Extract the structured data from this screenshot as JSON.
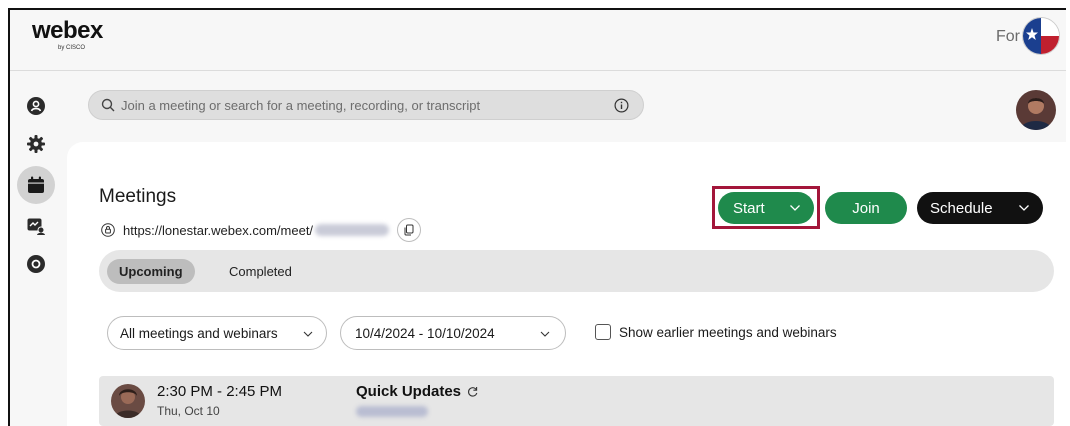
{
  "header": {
    "logo_text": "webex",
    "logo_subtext": "by CISCO",
    "user_name": "For"
  },
  "sidebar": {
    "items": [
      {
        "icon": "contacts-icon"
      },
      {
        "icon": "gear-icon"
      },
      {
        "icon": "calendar-icon",
        "active": true
      },
      {
        "icon": "whiteboard-icon"
      },
      {
        "icon": "record-icon"
      }
    ]
  },
  "search": {
    "placeholder": "Join a meeting or search for a meeting, recording, or transcript"
  },
  "meetings": {
    "title": "Meetings",
    "url_prefix": "https://lonestar.webex.com/meet/"
  },
  "actions": {
    "start_label": "Start",
    "join_label": "Join",
    "schedule_label": "Schedule"
  },
  "tabs": [
    {
      "label": "Upcoming",
      "active": true
    },
    {
      "label": "Completed",
      "active": false
    }
  ],
  "filters": {
    "type_value": "All meetings and webinars",
    "date_value": "10/4/2024 - 10/10/2024",
    "show_earlier_label": "Show earlier meetings and webinars"
  },
  "meeting_list": [
    {
      "time": "2:30 PM - 2:45 PM",
      "date": "Thu, Oct 10",
      "title": "Quick Updates"
    }
  ],
  "colors": {
    "accent_green": "#1f8a4c",
    "highlight": "#a3163a",
    "schedule_black": "#111111"
  }
}
